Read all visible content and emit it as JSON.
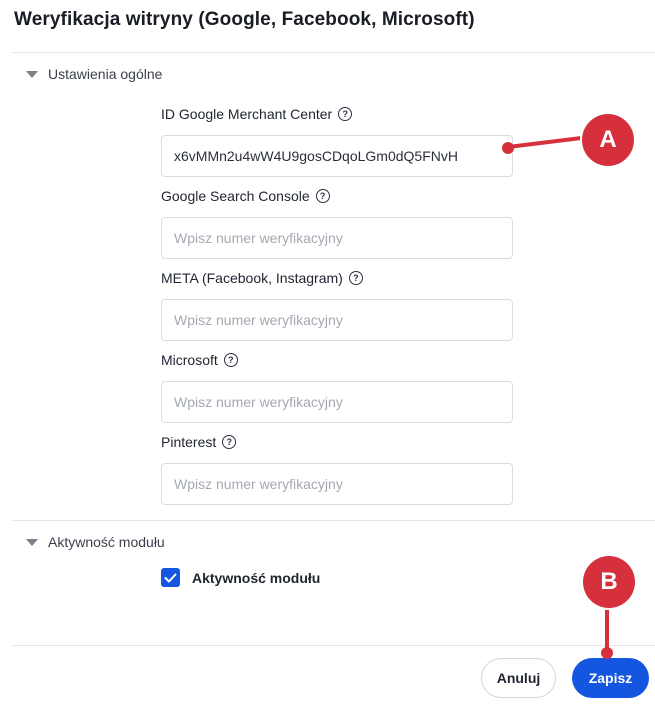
{
  "page": {
    "title": "Weryfikacja witryny (Google, Facebook, Microsoft)"
  },
  "sections": {
    "general": {
      "label": "Ustawienia ogólne"
    },
    "module": {
      "label": "Aktywność modułu"
    }
  },
  "fields": [
    {
      "label": "ID Google Merchant Center",
      "value": "x6vMMn2u4wW4U9gosCDqoLGm0dQ5FNvH",
      "placeholder": "Wpisz numer weryfikacyjny"
    },
    {
      "label": "Google Search Console",
      "value": "",
      "placeholder": "Wpisz numer weryfikacyjny"
    },
    {
      "label": "META (Facebook, Instagram)",
      "value": "",
      "placeholder": "Wpisz numer weryfikacyjny"
    },
    {
      "label": "Microsoft",
      "value": "",
      "placeholder": "Wpisz numer weryfikacyjny"
    },
    {
      "label": "Pinterest",
      "value": "",
      "placeholder": "Wpisz numer weryfikacyjny"
    }
  ],
  "module_checkbox": {
    "label": "Aktywność modułu",
    "checked": true
  },
  "actions": {
    "cancel_label": "Anuluj",
    "save_label": "Zapisz"
  },
  "annotations": {
    "a": "A",
    "b": "B"
  },
  "icons": {
    "help": "?",
    "check": "checkmark-icon",
    "caret": "caret-down-icon"
  },
  "colors": {
    "primary": "#1556e0",
    "annotation": "#d6303d"
  }
}
